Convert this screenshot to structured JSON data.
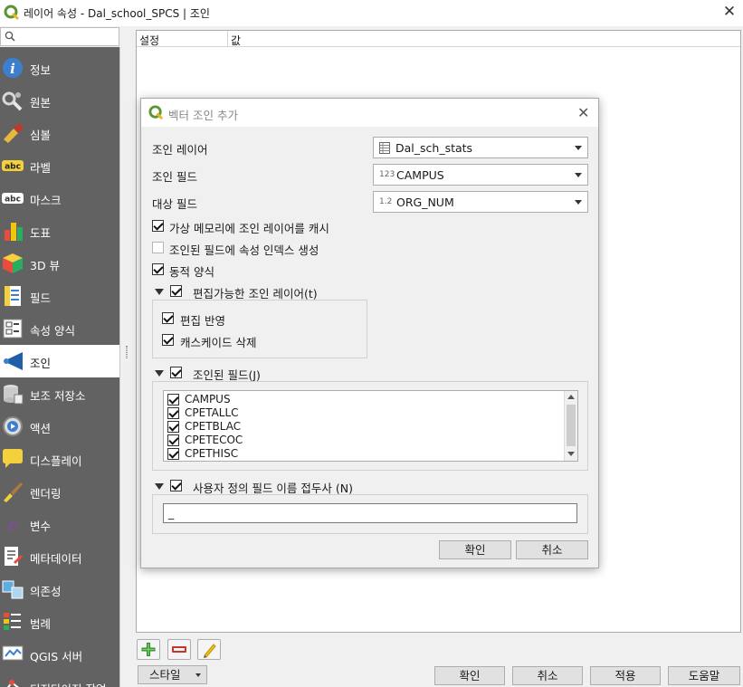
{
  "window": {
    "title": "레이어 속성 - Dal_school_SPCS | 조인",
    "close": "✕"
  },
  "sidebar": {
    "items": [
      {
        "label": "정보",
        "icon": "info-icon"
      },
      {
        "label": "원본",
        "icon": "source-icon"
      },
      {
        "label": "심볼",
        "icon": "symbology-icon"
      },
      {
        "label": "라벨",
        "icon": "labels-icon"
      },
      {
        "label": "마스크",
        "icon": "mask-icon"
      },
      {
        "label": "도표",
        "icon": "diagram-icon"
      },
      {
        "label": "3D 뷰",
        "icon": "3d-view-icon"
      },
      {
        "label": "필드",
        "icon": "fields-icon"
      },
      {
        "label": "속성 양식",
        "icon": "attributes-form-icon"
      },
      {
        "label": "조인",
        "icon": "joins-icon",
        "active": true
      },
      {
        "label": "보조 저장소",
        "icon": "auxiliary-storage-icon"
      },
      {
        "label": "액션",
        "icon": "actions-icon"
      },
      {
        "label": "디스플레이",
        "icon": "display-icon"
      },
      {
        "label": "렌더링",
        "icon": "rendering-icon"
      },
      {
        "label": "변수",
        "icon": "variables-icon"
      },
      {
        "label": "메타데이터",
        "icon": "metadata-icon"
      },
      {
        "label": "의존성",
        "icon": "dependencies-icon"
      },
      {
        "label": "범례",
        "icon": "legend-icon"
      },
      {
        "label": "QGIS 서버",
        "icon": "qgis-server-icon"
      },
      {
        "label": "디지타이징 작업",
        "icon": "digitizing-icon"
      }
    ]
  },
  "table": {
    "col_setting": "설정",
    "col_value": "값"
  },
  "bottom": {
    "style_label": "스타일",
    "ok": "확인",
    "cancel": "취소",
    "apply": "적용",
    "help": "도움말"
  },
  "dialog": {
    "title": "벡터 조인 추가",
    "join_layer_label": "조인 레이어",
    "join_layer_value": "Dal_sch_stats",
    "join_field_label": "조인 필드",
    "join_field_type": "123",
    "join_field_value": "CAMPUS",
    "target_field_label": "대상 필드",
    "target_field_type": "1.2",
    "target_field_value": "ORG_NUM",
    "cache_label": "가상 메모리에 조인 레이어를 캐시",
    "index_label": "조인된 필드에 속성 인덱스 생성",
    "dynamic_form_label": "동적 양식",
    "editable_label": "편집가능한 조인 레이어(t)",
    "upsert_label": "편집 반영",
    "cascade_label": "캐스케이드 삭제",
    "joined_fields_label": "조인된 필드(J)",
    "fields": [
      "CAMPUS",
      "CPETALLC",
      "CPETBLAC",
      "CPETECOC",
      "CPETHISC"
    ],
    "prefix_label": "사용자 정의 필드 이름 접두사 (N)",
    "prefix_value": "_",
    "ok": "확인",
    "cancel": "취소"
  },
  "colors": {
    "qgis_green": "#589632",
    "active_blue": "#1f5fa8"
  }
}
